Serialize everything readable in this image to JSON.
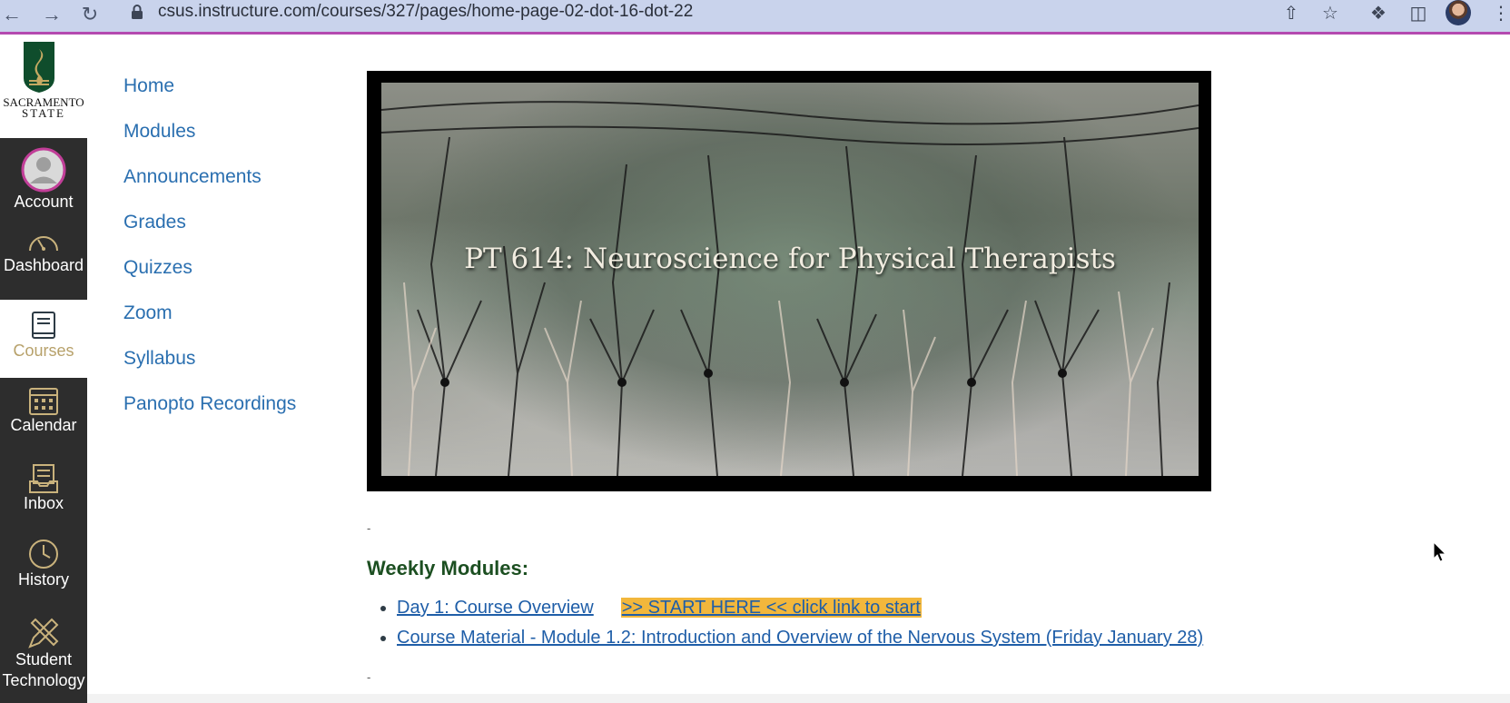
{
  "browser": {
    "url": "csus.instructure.com/courses/327/pages/home-page-02-dot-16-dot-22",
    "back_icon": "back-arrow-icon",
    "forward_icon": "forward-arrow-icon",
    "reload_icon": "reload-icon"
  },
  "logo": {
    "line1": "SACRAMENTO",
    "line2": "STATE"
  },
  "global_nav": {
    "items": [
      {
        "label": "Account",
        "icon": "avatar-icon"
      },
      {
        "label": "Dashboard",
        "icon": "speedometer-icon"
      },
      {
        "label": "Courses",
        "icon": "book-icon",
        "active": true
      },
      {
        "label": "Calendar",
        "icon": "calendar-icon"
      },
      {
        "label": "Inbox",
        "icon": "inbox-icon"
      },
      {
        "label": "History",
        "icon": "clock-icon"
      },
      {
        "label": "Student",
        "label2": "Technology",
        "icon": "pencil-ruler-icon"
      }
    ]
  },
  "course_nav": {
    "items": [
      "Home",
      "Modules",
      "Announcements",
      "Grades",
      "Quizzes",
      "Zoom",
      "Syllabus",
      "Panopto Recordings"
    ]
  },
  "banner": {
    "title": "PT 614: Neuroscience for Physical Therapists"
  },
  "content": {
    "separator": "-",
    "weekly_heading": "Weekly Modules:",
    "modules": [
      {
        "link": "Day 1: Course Overview",
        "highlight": ">> START HERE << click link to start"
      },
      {
        "link": "Course Material - Module 1.2: Introduction and Overview of the Nervous System (Friday January 28)"
      }
    ]
  },
  "colors": {
    "link": "#2a6fb0",
    "active_nav": "#b7a16a",
    "highlight": "#f2b73c",
    "heading": "#1c4f21"
  }
}
